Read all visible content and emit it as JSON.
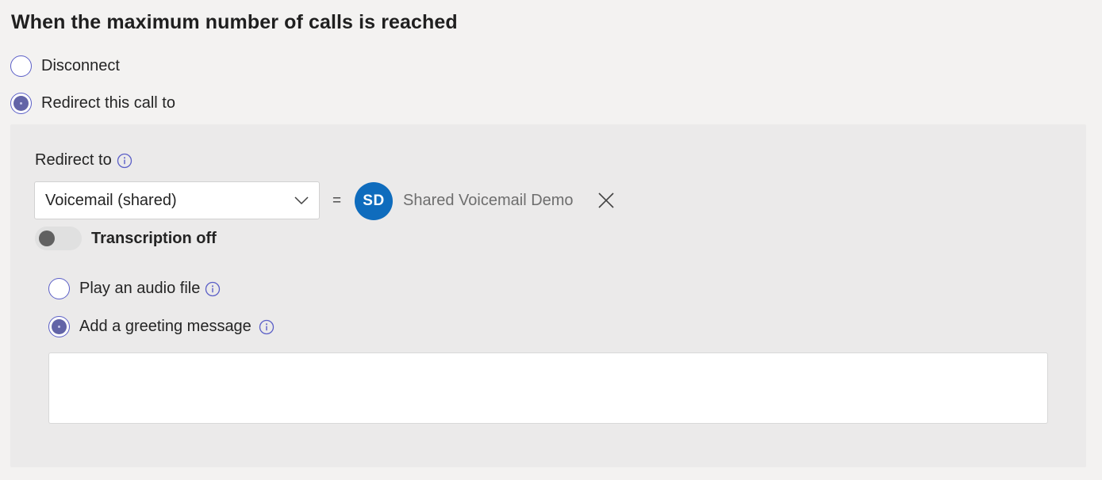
{
  "heading": "When the maximum number of calls is reached",
  "options": {
    "disconnect": {
      "label": "Disconnect",
      "selected": false
    },
    "redirect": {
      "label": "Redirect this call to",
      "selected": true
    }
  },
  "redirect": {
    "label": "Redirect to",
    "info_icon": "info-circle-icon",
    "selected_value": "Voicemail (shared)",
    "equals": "=",
    "target": {
      "initials": "SD",
      "name": "Shared Voicemail Demo",
      "avatar_color": "#0f6cbd"
    },
    "remove_icon": "close-icon"
  },
  "transcription": {
    "label": "Transcription off",
    "enabled": false
  },
  "greeting_options": {
    "audio_file": {
      "label": "Play an audio file",
      "selected": false
    },
    "greeting_message": {
      "label": "Add a greeting message",
      "selected": true
    }
  },
  "greeting_text": {
    "value": "",
    "placeholder": ""
  },
  "colors": {
    "accent": "#6264a7",
    "background": "#f3f2f1",
    "panel": "#ebeaea"
  }
}
